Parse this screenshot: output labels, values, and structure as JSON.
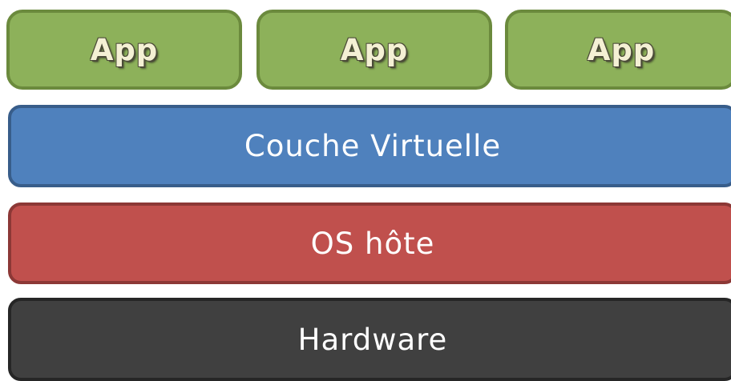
{
  "apps": [
    {
      "label": "App"
    },
    {
      "label": "App"
    },
    {
      "label": "App"
    }
  ],
  "layers": {
    "virtual": {
      "label": "Couche Virtuelle",
      "color": "#4f81bd"
    },
    "host_os": {
      "label": "OS hôte",
      "color": "#c0504d"
    },
    "hardware": {
      "label": "Hardware",
      "color": "#404040"
    }
  },
  "colors": {
    "app": "#8db15a",
    "app_text": "#f4f0d4"
  }
}
